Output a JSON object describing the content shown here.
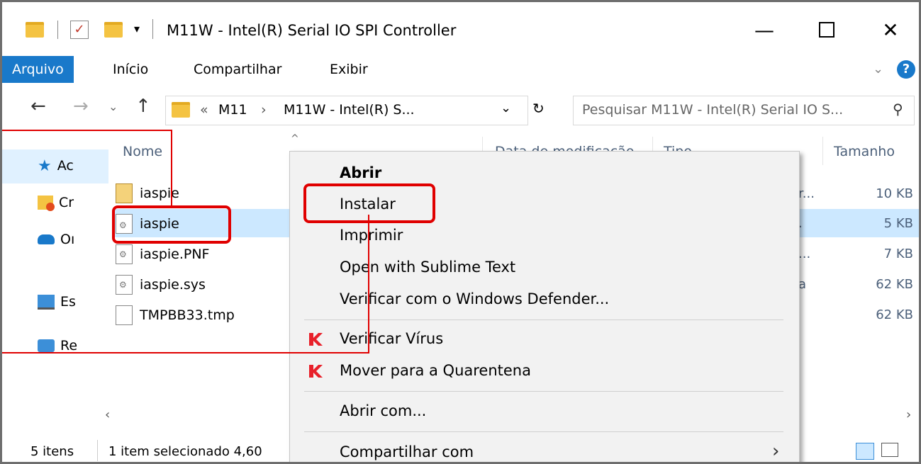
{
  "window": {
    "title": "M11W - Intel(R) Serial IO SPI Controller"
  },
  "ribbon": {
    "tabs": [
      "Arquivo",
      "Início",
      "Compartilhar",
      "Exibir"
    ]
  },
  "nav": {
    "breadcrumb_prefix": "«",
    "crumbs": [
      "M11",
      "M11W - Intel(R) S..."
    ],
    "crumb_sep": "›",
    "search_placeholder": "Pesquisar M11W - Intel(R) Serial IO S..."
  },
  "sidebar": {
    "items": [
      "Ac",
      "Cr",
      "Oı",
      "Es",
      "Re"
    ]
  },
  "columns": {
    "name": "Nome",
    "date": "Data de modificação",
    "type": "Tipo",
    "size": "Tamanho"
  },
  "files": [
    {
      "name": "iaspie",
      "type": "r...",
      "size": "10 KB"
    },
    {
      "name": "iaspie",
      "type": ".",
      "size": "5 KB"
    },
    {
      "name": "iaspie.PNF",
      "type": "...",
      "size": "7 KB"
    },
    {
      "name": "iaspie.sys",
      "type": "a",
      "size": "62 KB"
    },
    {
      "name": "TMPBB33.tmp",
      "type": "",
      "size": "62 KB"
    }
  ],
  "status": {
    "count": "5 itens",
    "selection": "1 item selecionado 4,60"
  },
  "context_menu": {
    "items": [
      "Abrir",
      "Instalar",
      "Imprimir",
      "Open with Sublime Text",
      "Verificar com o Windows Defender...",
      "Verificar Vírus",
      "Mover para a Quarentena",
      "Abrir com...",
      "Compartilhar com"
    ]
  },
  "colors": {
    "accent": "#1979ca",
    "selection": "#cce8ff",
    "annotation": "#e00000"
  }
}
